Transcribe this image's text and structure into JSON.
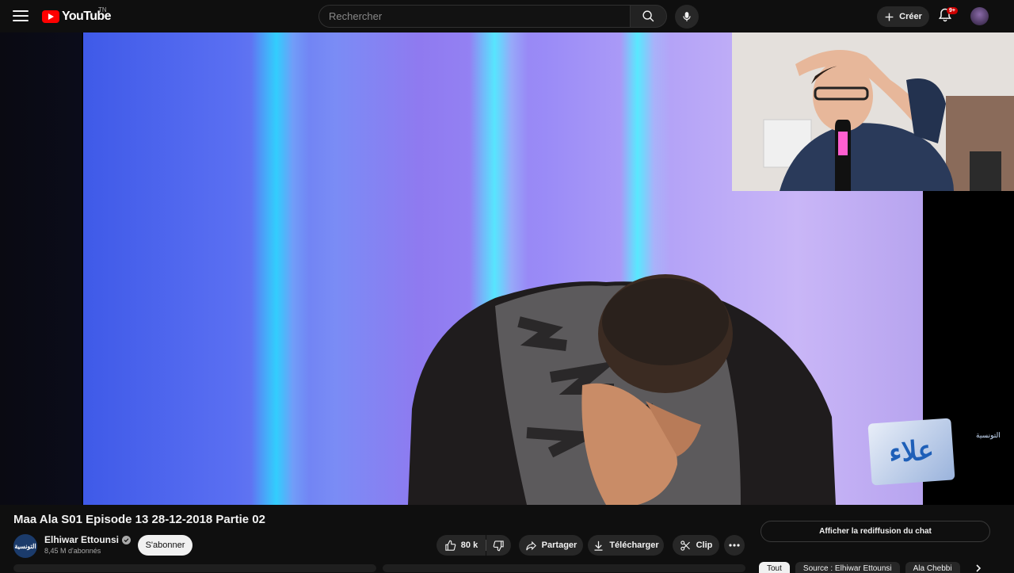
{
  "header": {
    "logo_text": "YouTube",
    "country_code": "TN",
    "search_placeholder": "Rechercher",
    "create_label": "Créer",
    "notification_count": "9+"
  },
  "video": {
    "title": "Maa Ala S01 Episode 13 28-12-2018 Partie 02",
    "overlay_logo_text": "علاء",
    "watermark_text": "التونسية"
  },
  "channel": {
    "name": "Elhiwar Ettounsi",
    "avatar_text": "التونسية",
    "subscribers": "8,45 M d'abonnés",
    "subscribe_label": "S'abonner"
  },
  "actions": {
    "likes": "80 k",
    "share_label": "Partager",
    "download_label": "Télécharger",
    "clip_label": "Clip"
  },
  "chat": {
    "replay_label": "Afficher la rediffusion du chat"
  },
  "chips": [
    {
      "label": "Tout"
    },
    {
      "label": "Source : Elhiwar Ettounsi"
    },
    {
      "label": "Ala Chebbi"
    }
  ],
  "colors": {
    "brand_red": "#ff0000",
    "background": "#0f0f0f",
    "surface": "#272727",
    "notification_badge": "#cc0000"
  }
}
